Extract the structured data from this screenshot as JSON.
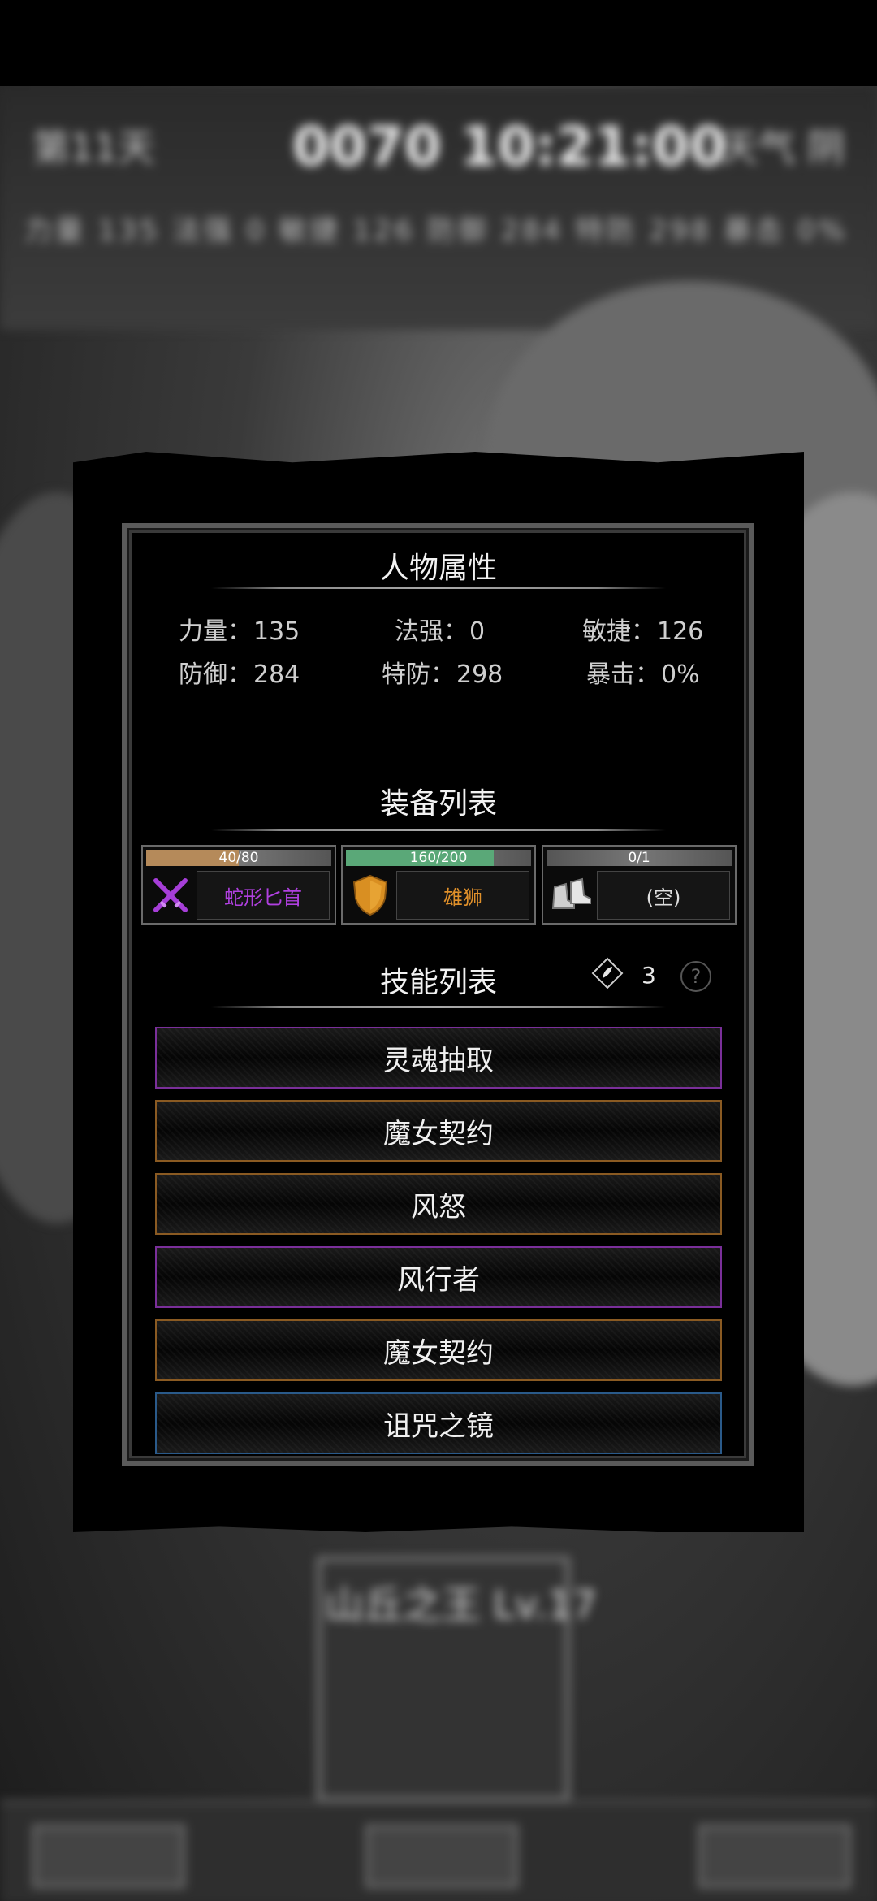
{
  "background": {
    "day": "第11天",
    "clock": "0070 10:21:00",
    "weather": "天气 阴",
    "stat_line": "力量 135   法强 0   敏捷 126   防御 284   特防 298   暴击 0%",
    "bottom_title": "山丘之王 Lv.17"
  },
  "attributes": {
    "title": "人物属性",
    "stats": [
      {
        "label": "力量：",
        "value": "135"
      },
      {
        "label": "法强：",
        "value": "0"
      },
      {
        "label": "敏捷：",
        "value": "126"
      },
      {
        "label": "防御：",
        "value": "284"
      },
      {
        "label": "特防：",
        "value": "298"
      },
      {
        "label": "暴击：",
        "value": "0%"
      }
    ]
  },
  "equipment": {
    "title": "装备列表",
    "items": [
      {
        "durability": "40/80",
        "fill": 0.5,
        "bar_color": "#b58a5a",
        "name": "蛇形匕首",
        "name_color": "#b040e0",
        "icon": "crossed-daggers-icon"
      },
      {
        "durability": "160/200",
        "fill": 0.8,
        "bar_color": "#5aa878",
        "name": "雄狮",
        "name_color": "#e0902a",
        "icon": "shield-icon"
      },
      {
        "durability": "0/1",
        "fill": 0.0,
        "bar_color": "#777777",
        "name": "(空)",
        "name_color": "#e0e0e0",
        "icon": "boots-icon"
      }
    ]
  },
  "skills": {
    "title": "技能列表",
    "points": "3",
    "items": [
      {
        "name": "灵魂抽取",
        "rarity": "purple"
      },
      {
        "name": "魔女契约",
        "rarity": "orange"
      },
      {
        "name": "风怒",
        "rarity": "orange"
      },
      {
        "name": "风行者",
        "rarity": "purple"
      },
      {
        "name": "魔女契约",
        "rarity": "orange"
      },
      {
        "name": "诅咒之镜",
        "rarity": "blue"
      }
    ]
  }
}
